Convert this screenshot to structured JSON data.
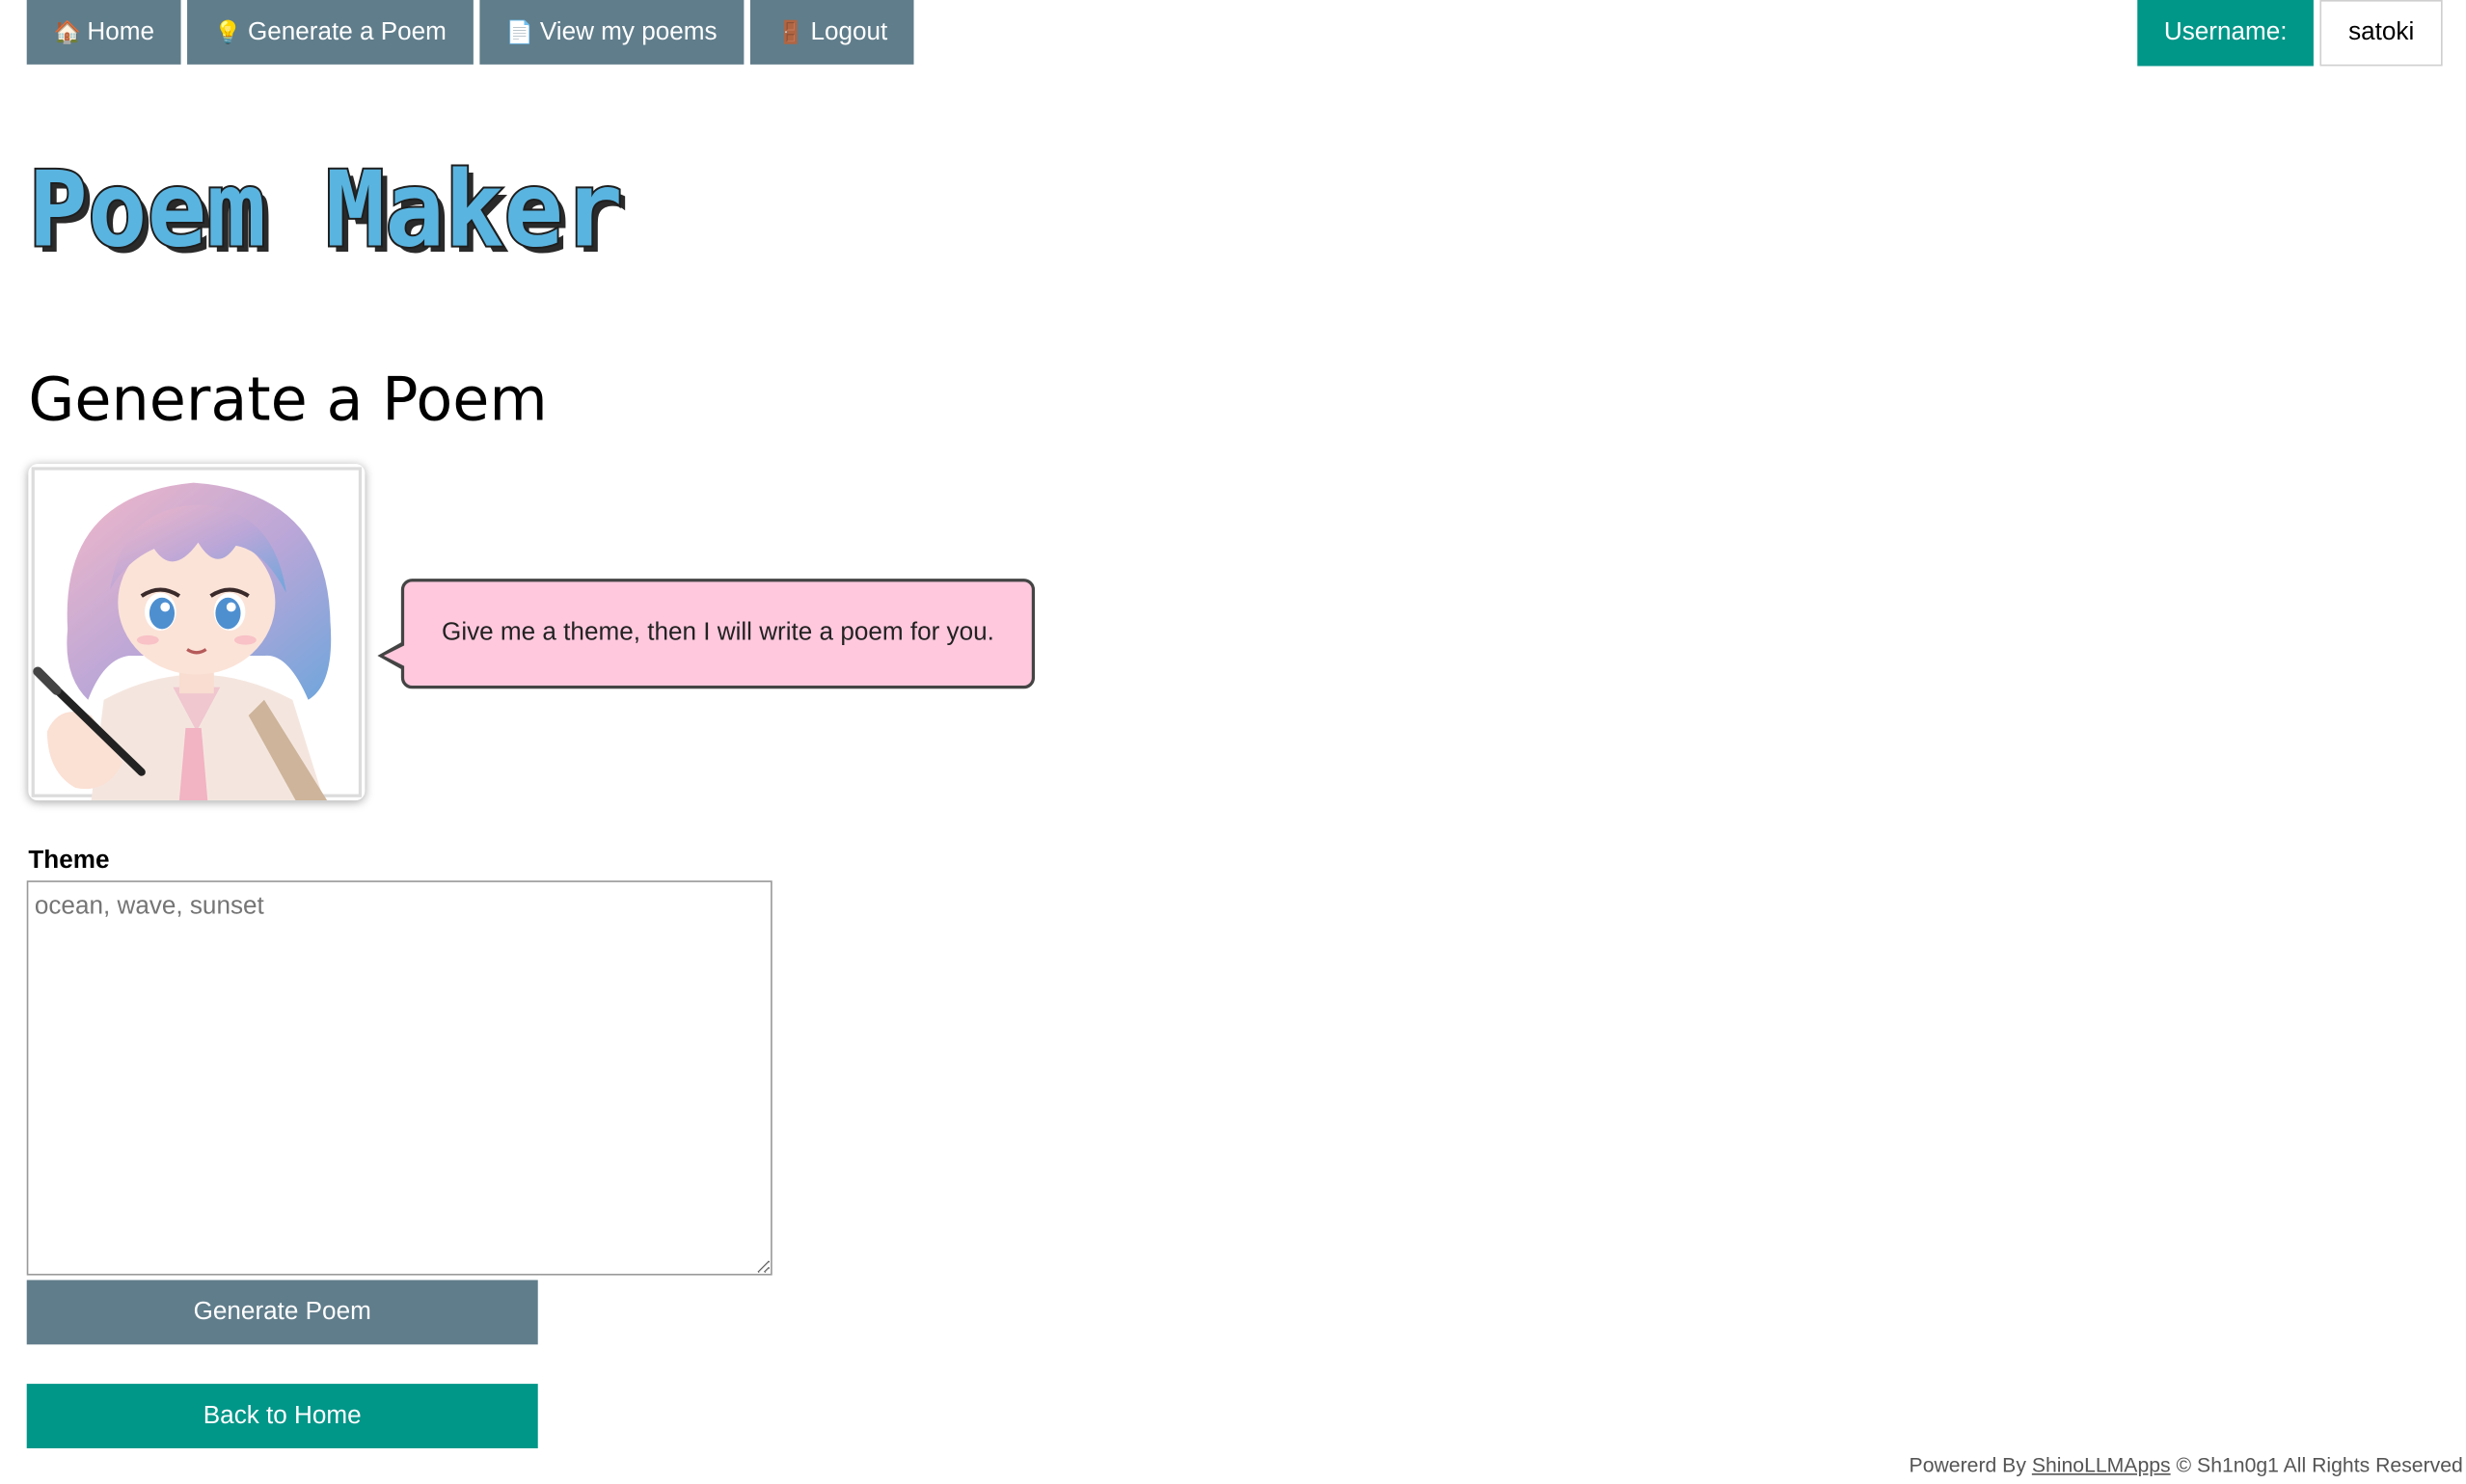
{
  "nav": {
    "items": [
      {
        "label": "Home",
        "icon": "house-icon",
        "icon_glyph": "🏠"
      },
      {
        "label": "Generate a Poem",
        "icon": "lightbulb-icon",
        "icon_glyph": "💡"
      },
      {
        "label": "View my poems",
        "icon": "page-icon",
        "icon_glyph": "📄"
      },
      {
        "label": "Logout",
        "icon": "door-icon",
        "icon_glyph": "🚪"
      }
    ]
  },
  "user": {
    "label": "Username:",
    "name": "satoki"
  },
  "logo": {
    "text": "Poem Maker",
    "color": "#5ab4e0"
  },
  "page": {
    "title": "Generate a Poem"
  },
  "assistant": {
    "message": "Give me a theme, then I will write a poem for you."
  },
  "form": {
    "theme_label": "Theme",
    "theme_value": "",
    "theme_placeholder": "ocean, wave, sunset",
    "generate_label": "Generate Poem",
    "back_label": "Back to Home"
  },
  "footer": {
    "prefix": "Powererd By",
    "link": "ShinoLLMApps",
    "suffix": "© Sh1n0g1 All Rights Reserved"
  },
  "colors": {
    "nav_bg": "#607d8b",
    "accent": "#009688",
    "bubble_bg": "#ffc8dd"
  }
}
